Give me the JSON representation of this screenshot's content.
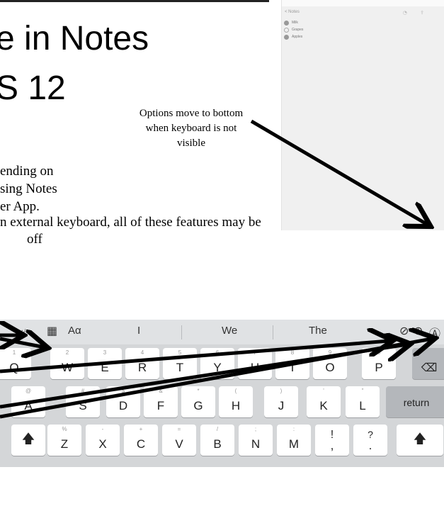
{
  "slide": {
    "title_line1": "e in Notes",
    "title_line2": "S 12",
    "callout": "Options move to bottom when keyboard is not visible",
    "body": [
      "ending on",
      "sing Notes",
      "er App.",
      "n external keyboard, all of these features may be",
      "off"
    ]
  },
  "phone": {
    "back_label": "< Notes",
    "toolbar_icons": "◔ ⇪",
    "items": [
      {
        "label": "Milk",
        "done": true
      },
      {
        "label": "Grapes",
        "done": false
      },
      {
        "label": "Apples",
        "done": true
      }
    ],
    "bottom_icons": "◫ ✎"
  },
  "keyboard": {
    "suggestions": [
      "I",
      "We",
      "The"
    ],
    "toolbar_left": {
      "aa_label": "Aα"
    },
    "rows": [
      [
        {
          "main": "Q",
          "sub": "1"
        },
        {
          "main": "W",
          "sub": "2"
        },
        {
          "main": "E",
          "sub": "3"
        },
        {
          "main": "R",
          "sub": "4"
        },
        {
          "main": "T",
          "sub": "5"
        },
        {
          "main": "Y",
          "sub": "6"
        },
        {
          "main": "U",
          "sub": "7"
        },
        {
          "main": "I",
          "sub": "8"
        },
        {
          "main": "O",
          "sub": "9"
        },
        {
          "main": "P",
          "sub": "0"
        }
      ],
      [
        {
          "main": "A",
          "sub": "@"
        },
        {
          "main": "S",
          "sub": "#"
        },
        {
          "main": "D",
          "sub": "$"
        },
        {
          "main": "F",
          "sub": "&"
        },
        {
          "main": "G",
          "sub": "*"
        },
        {
          "main": "H",
          "sub": "("
        },
        {
          "main": "J",
          "sub": ")"
        },
        {
          "main": "K",
          "sub": "'"
        },
        {
          "main": "L",
          "sub": "\""
        }
      ],
      [
        {
          "main": "Z",
          "sub": "%"
        },
        {
          "main": "X",
          "sub": "-"
        },
        {
          "main": "C",
          "sub": "+"
        },
        {
          "main": "V",
          "sub": "="
        },
        {
          "main": "B",
          "sub": "/"
        },
        {
          "main": "N",
          "sub": ";"
        },
        {
          "main": "M",
          "sub": ":"
        },
        {
          "main": "!",
          "sub": ""
        },
        {
          "main": "?",
          "sub": ""
        }
      ]
    ],
    "return_label": "return",
    "comma_label": ",",
    "period_label": "."
  }
}
